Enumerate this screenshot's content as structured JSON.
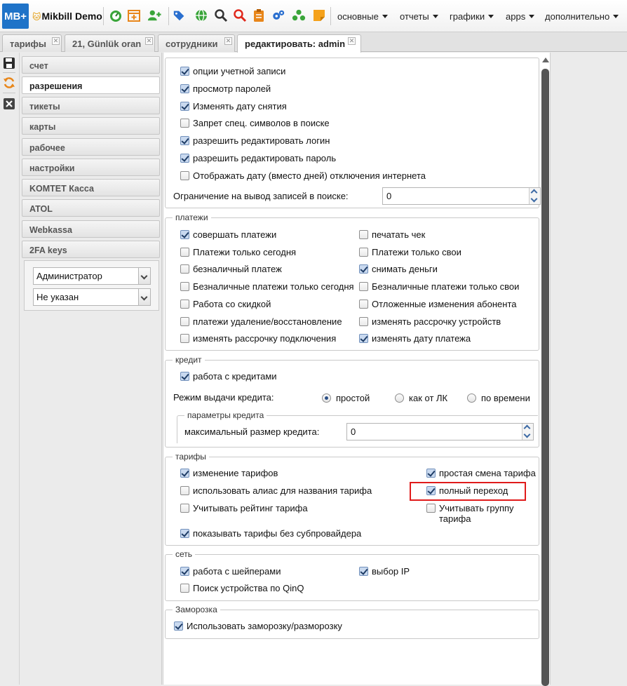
{
  "app": {
    "logo": "MB+",
    "brand": "Mikbill Demo",
    "menus": [
      "основные",
      "отчеты",
      "графики",
      "apps",
      "дополнительно"
    ]
  },
  "tabs": [
    {
      "label": "тарифы"
    },
    {
      "label": "21, Günlük oran"
    },
    {
      "label": "сотрудники"
    },
    {
      "label": "редактировать: admin"
    }
  ],
  "nav": {
    "items": [
      "счет",
      "разрешения",
      "тикеты",
      "карты",
      "рабочее",
      "настройки",
      "KOMTET Касса",
      "ATOL",
      "Webkassa",
      "2FA keys"
    ],
    "select_role": "Администратор",
    "select_other": "Не указан"
  },
  "account": {
    "checks": [
      {
        "label": "опции учетной записи",
        "checked": true
      },
      {
        "label": "просмотр паролей",
        "checked": true
      },
      {
        "label": "Изменять дату снятия",
        "checked": true
      },
      {
        "label": "Запрет спец. символов в поиске",
        "checked": false
      },
      {
        "label": "разрешить редактировать логин",
        "checked": true
      },
      {
        "label": "разрешить редактировать пароль",
        "checked": true
      },
      {
        "label": "Отображать дату (вместо дней) отключения интернета",
        "checked": false
      }
    ],
    "limit_label": "Ограничение на вывод записей в поиске:",
    "limit_value": "0"
  },
  "payments": {
    "legend": "платежи",
    "left": [
      {
        "label": "совершать платежи",
        "checked": true
      },
      {
        "label": "Платежи только сегодня",
        "checked": false
      },
      {
        "label": "безналичный платеж",
        "checked": false
      },
      {
        "label": "Безналичные платежи только сегодня",
        "checked": false
      },
      {
        "label": "Работа со скидкой",
        "checked": false
      },
      {
        "label": "платежи удаление/восстановление",
        "checked": false
      },
      {
        "label": "изменять рассрочку подключения",
        "checked": false
      }
    ],
    "right": [
      {
        "label": "печатать чек",
        "checked": false
      },
      {
        "label": "Платежи только свои",
        "checked": false
      },
      {
        "label": "снимать деньги",
        "checked": true
      },
      {
        "label": "Безналичные платежи только свои",
        "checked": false
      },
      {
        "label": "Отложенные изменения абонента",
        "checked": false
      },
      {
        "label": "изменять рассрочку устройств",
        "checked": false
      },
      {
        "label": "изменять дату платежа",
        "checked": true
      }
    ]
  },
  "credit": {
    "legend": "кредит",
    "work": {
      "label": "работа с кредитами",
      "checked": true
    },
    "mode_label": "Режим выдачи кредита:",
    "modes": [
      {
        "label": "простой",
        "selected": true
      },
      {
        "label": "как от ЛК",
        "selected": false
      },
      {
        "label": "по времени",
        "selected": false
      }
    ],
    "params_legend": "параметры кредита",
    "max_label": "максимальный размер кредита:",
    "max_value": "0"
  },
  "tariffs": {
    "legend": "тарифы",
    "left": [
      {
        "label": "изменение тарифов",
        "checked": true
      },
      {
        "label": "использовать алиас для названия тарифа",
        "checked": false
      },
      {
        "label": "Учитывать рейтинг тарифа",
        "checked": false
      },
      {
        "label": "показывать тарифы без субпровайдера",
        "checked": true
      }
    ],
    "right": [
      {
        "label": "простая смена тарифа",
        "checked": true
      },
      {
        "label": "полный переход",
        "checked": true
      },
      {
        "label": "Учитывать группу",
        "label2": "тарифа",
        "checked": false
      }
    ]
  },
  "network": {
    "legend": "сеть",
    "left": [
      {
        "label": "работа с шейперами",
        "checked": true
      },
      {
        "label": "Поиск устройства по QinQ",
        "checked": false
      }
    ],
    "right": [
      {
        "label": "выбор IP",
        "checked": true
      }
    ]
  },
  "freeze": {
    "legend": "Заморозка",
    "check": {
      "label": "Использовать заморозку/разморозку",
      "checked": true
    }
  },
  "colors": {
    "logo_bg": "#1f73c8",
    "highlight": "#e01b1b",
    "checkbox_on": "#c9d9ef"
  }
}
